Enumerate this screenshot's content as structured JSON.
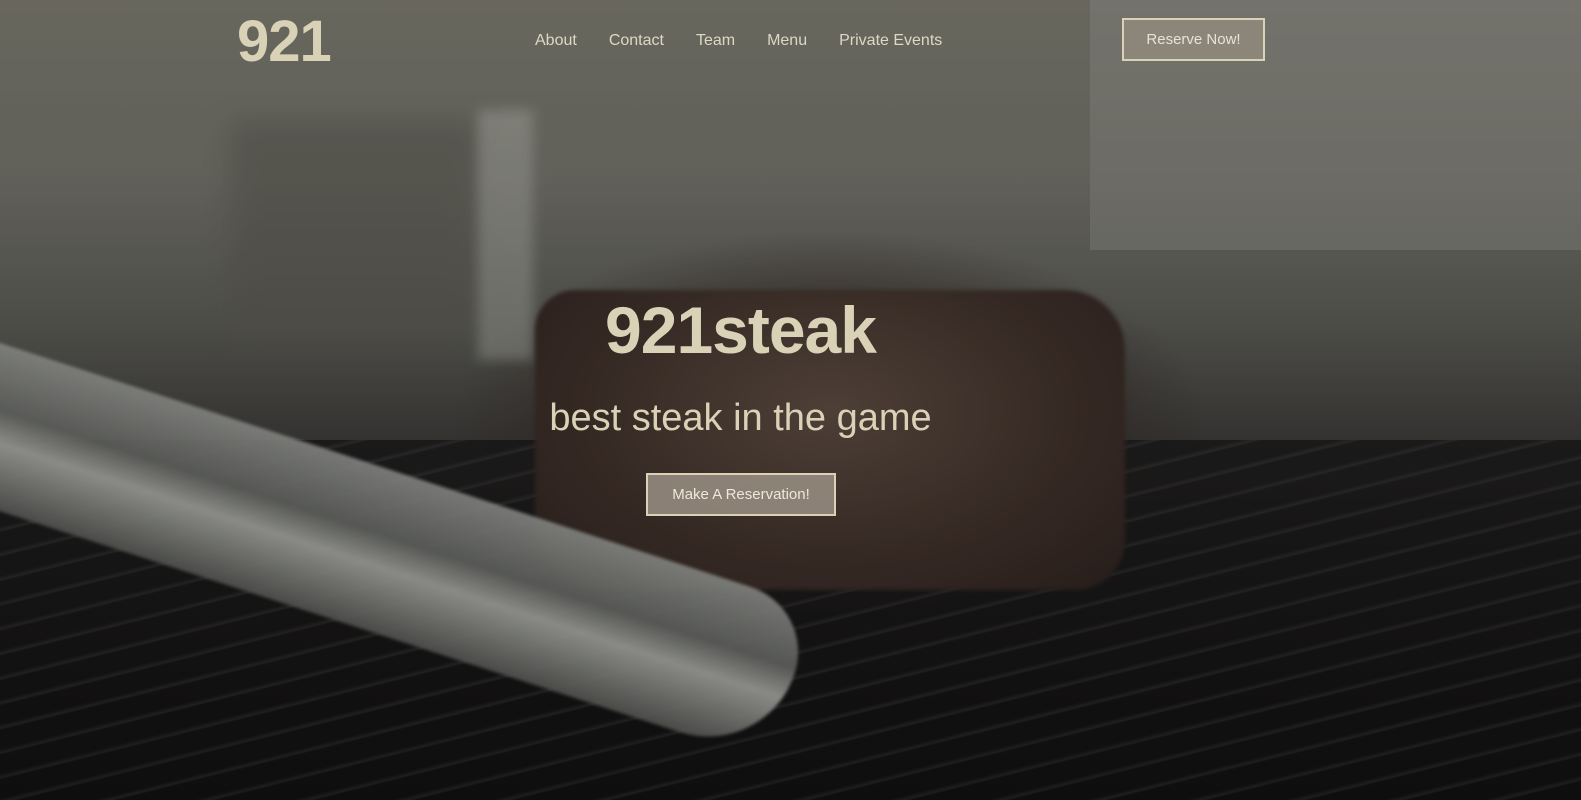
{
  "brand": {
    "logo_text": "921"
  },
  "nav": {
    "links": [
      {
        "label": "About"
      },
      {
        "label": "Contact"
      },
      {
        "label": "Team"
      },
      {
        "label": "Menu"
      },
      {
        "label": "Private Events"
      }
    ],
    "reserve_label": "Reserve Now!"
  },
  "hero": {
    "title": "921steak",
    "subtitle": "best steak in the game",
    "cta_label": "Make A Reservation!"
  },
  "colors": {
    "text": "#d9d2b6",
    "button_fill": "#968c80"
  }
}
